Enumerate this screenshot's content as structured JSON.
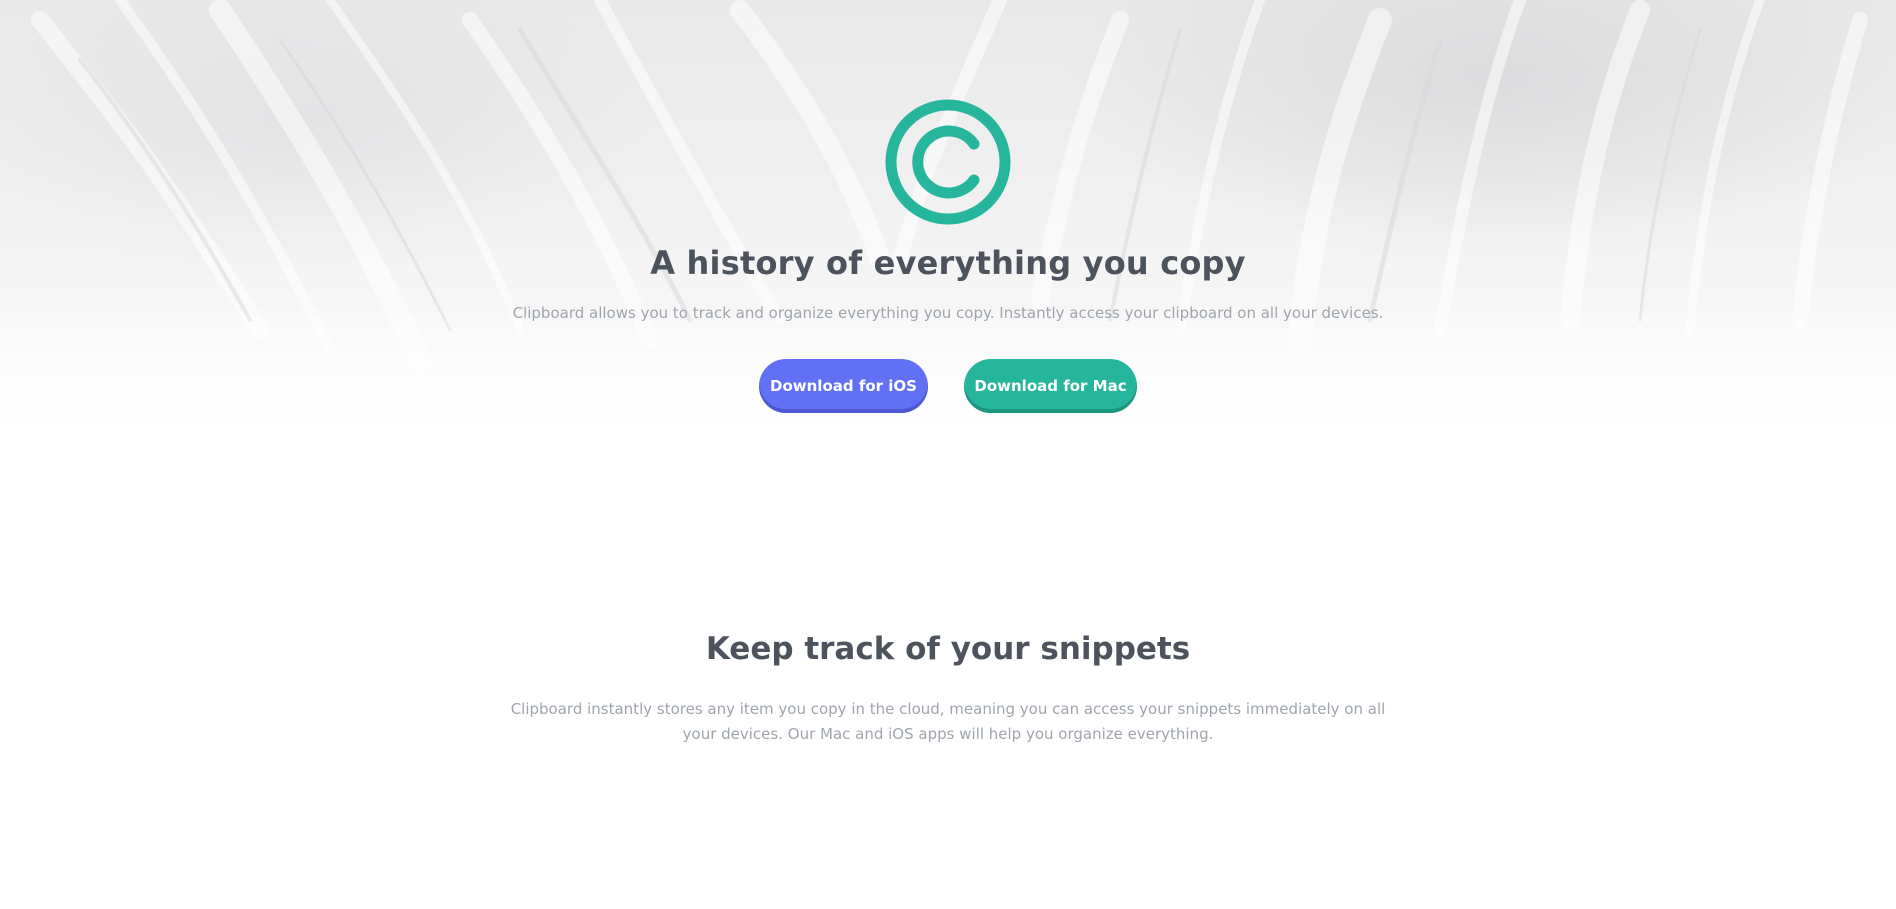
{
  "hero": {
    "logo_icon": "clipboard-copyright-logo-icon",
    "title": "A history of everything you copy",
    "subtitle": "Clipboard allows you to track and organize everything you copy. Instantly access your clipboard on all your devices.",
    "buttons": {
      "ios_label": "Download for iOS",
      "mac_label": "Download for Mac"
    }
  },
  "snippets": {
    "title": "Keep track of your snippets",
    "text": "Clipboard instantly stores any item you copy in the cloud, meaning you can access your snippets immediately on all your devices. Our Mac and iOS apps will help you organize everything."
  },
  "colors": {
    "accent_teal": "#26b59d",
    "accent_blue": "#6270f6",
    "heading": "#4c535d",
    "body_text": "#9fa5ad"
  }
}
